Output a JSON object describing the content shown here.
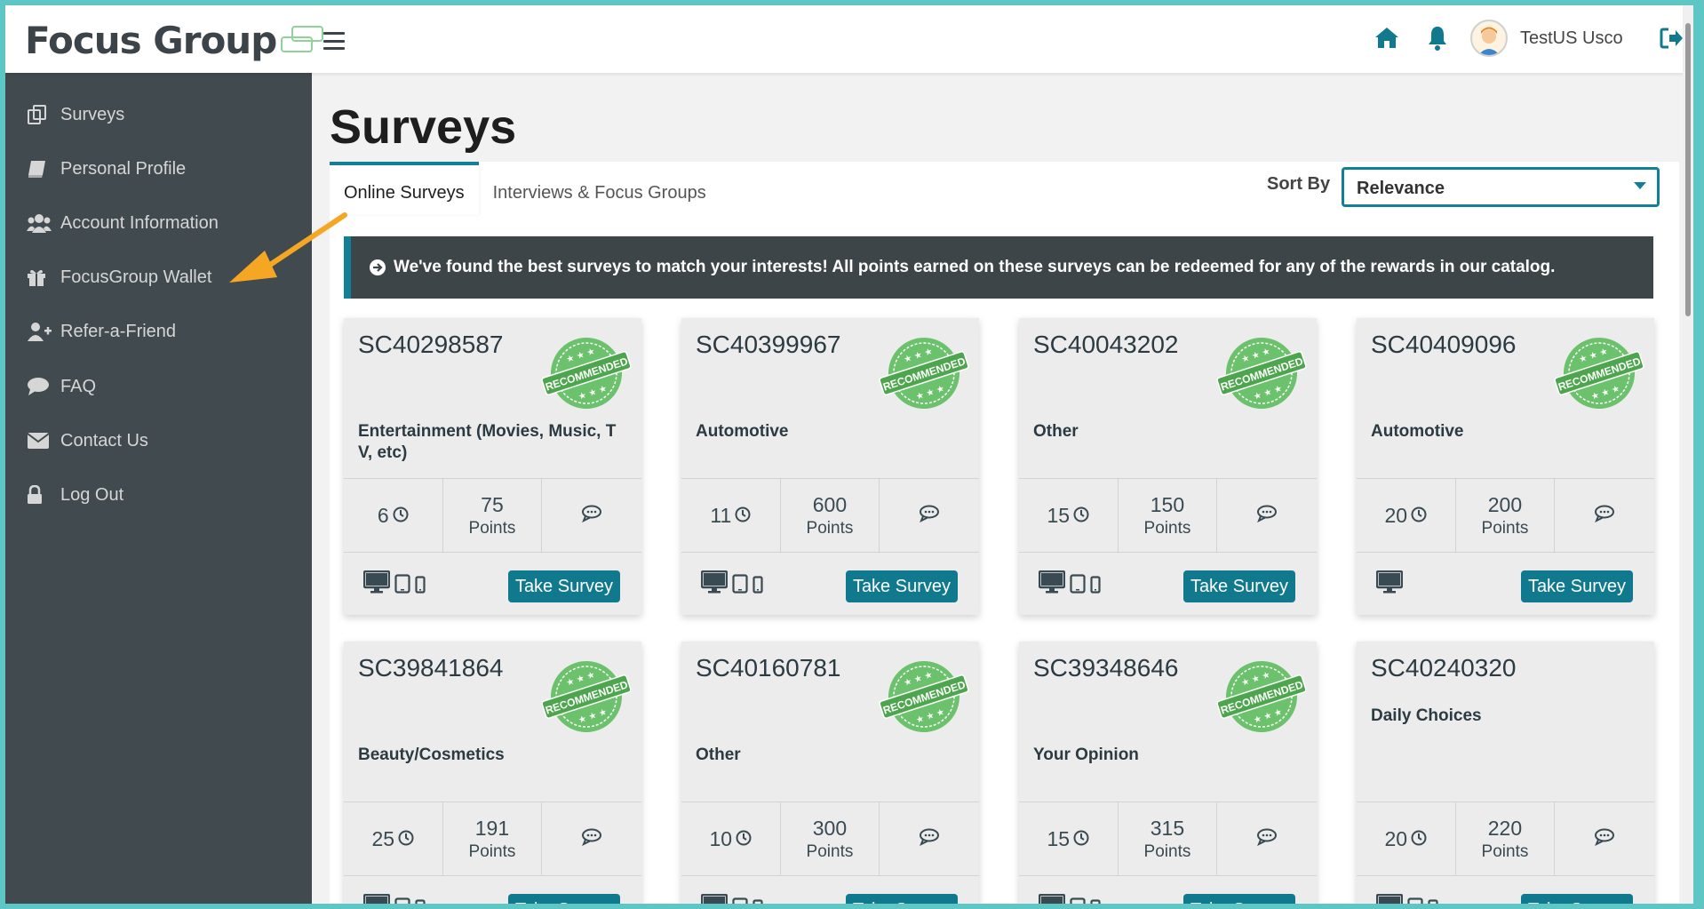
{
  "header": {
    "logo_text": "Focus Group",
    "username": "TestUS Usco"
  },
  "sidebar": {
    "items": [
      {
        "label": "Surveys",
        "icon": "copy-icon"
      },
      {
        "label": "Personal Profile",
        "icon": "book-icon"
      },
      {
        "label": "Account Information",
        "icon": "users-icon"
      },
      {
        "label": "FocusGroup Wallet",
        "icon": "gift-icon"
      },
      {
        "label": "Refer-a-Friend",
        "icon": "user-plus-icon"
      },
      {
        "label": "FAQ",
        "icon": "comment-icon"
      },
      {
        "label": "Contact Us",
        "icon": "envelope-icon"
      },
      {
        "label": "Log Out",
        "icon": "lock-icon"
      }
    ]
  },
  "main": {
    "title": "Surveys",
    "tabs": [
      "Online Surveys",
      "Interviews & Focus Groups"
    ],
    "sort_label": "Sort By",
    "sort_value": "Relevance",
    "notice": "We've found the best surveys to match your interests! All points earned on these surveys can be redeemed for any of the rewards in our catalog."
  },
  "cards": [
    {
      "id": "SC40298587",
      "category": "Entertainment (Movies, Music, T V, etc)",
      "minutes": "6",
      "points": "75",
      "points_label": "Points",
      "recommended": true,
      "button": "Take Survey"
    },
    {
      "id": "SC40399967",
      "category": "Automotive",
      "minutes": "11",
      "points": "600",
      "points_label": "Points",
      "recommended": true,
      "button": "Take Survey"
    },
    {
      "id": "SC40043202",
      "category": "Other",
      "minutes": "15",
      "points": "150",
      "points_label": "Points",
      "recommended": true,
      "button": "Take Survey"
    },
    {
      "id": "SC40409096",
      "category": "Automotive",
      "minutes": "20",
      "points": "200",
      "points_label": "Points",
      "recommended": true,
      "button": "Take Survey"
    },
    {
      "id": "SC39841864",
      "category": "Beauty/Cosmetics",
      "minutes": "25",
      "points": "191",
      "points_label": "Points",
      "recommended": true,
      "button": "Take Survey"
    },
    {
      "id": "SC40160781",
      "category": "Other",
      "minutes": "10",
      "points": "300",
      "points_label": "Points",
      "recommended": true,
      "button": "Take Survey"
    },
    {
      "id": "SC39348646",
      "category": "Your Opinion",
      "minutes": "15",
      "points": "315",
      "points_label": "Points",
      "recommended": true,
      "button": "Take Survey"
    },
    {
      "id": "SC40240320",
      "category": "Daily Choices",
      "minutes": "20",
      "points": "220",
      "points_label": "Points",
      "recommended": false,
      "button": "Take Survey"
    }
  ],
  "badge_text": "RECOMMENDED",
  "colors": {
    "accent": "#10798e",
    "sidebar_bg": "#414a4f",
    "badge_green": "#5cb85c",
    "arrow": "#f5a623",
    "frame": "#5fc6c6"
  }
}
